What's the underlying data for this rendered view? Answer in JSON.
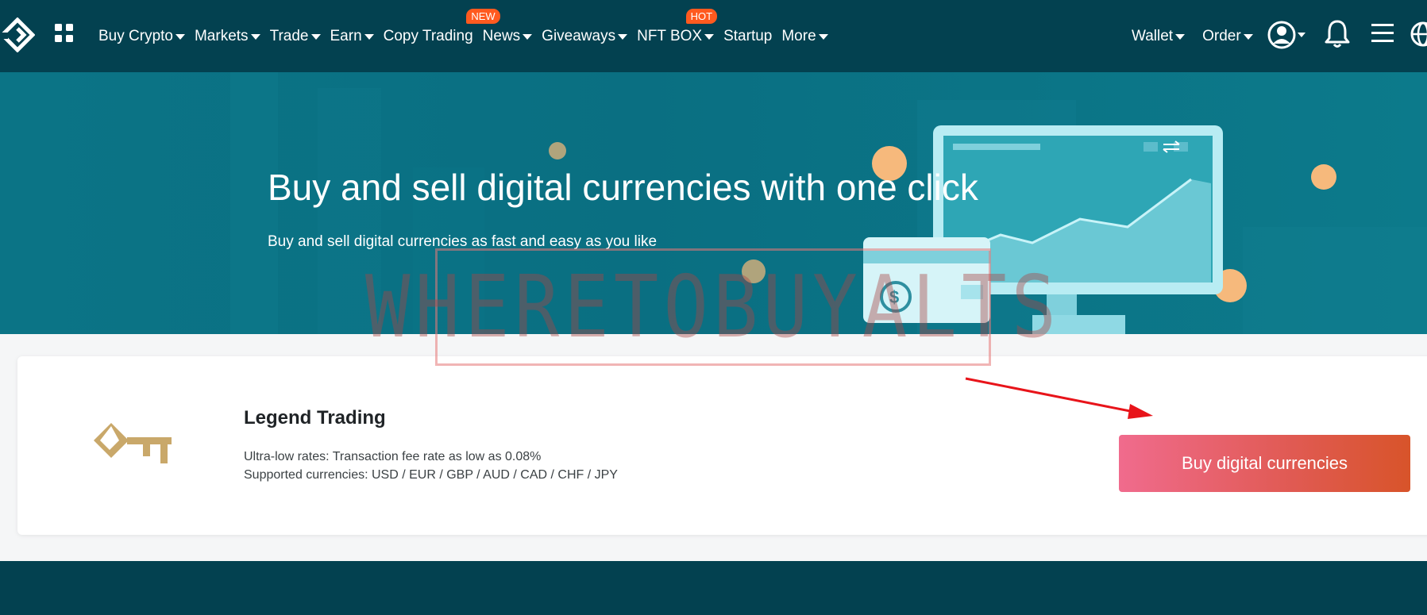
{
  "topnav": {
    "logo_icon": "exchange-logo-icon",
    "apps_icon": "grid-apps-icon",
    "menu": [
      {
        "label": "Buy Crypto",
        "dropdown": true
      },
      {
        "label": "Markets",
        "dropdown": true
      },
      {
        "label": "Trade",
        "dropdown": true
      },
      {
        "label": "Earn",
        "dropdown": true
      },
      {
        "label": "Copy Trading",
        "dropdown": false,
        "badge": "NEW"
      },
      {
        "label": "News",
        "dropdown": true
      },
      {
        "label": "Giveaways",
        "dropdown": true
      },
      {
        "label": "NFT BOX",
        "dropdown": true,
        "badge": "HOT"
      },
      {
        "label": "Startup",
        "dropdown": false
      },
      {
        "label": "More",
        "dropdown": true
      }
    ],
    "right": {
      "wallet_label": "Wallet",
      "order_label": "Order",
      "user_icon": "user-avatar-icon",
      "bell_icon": "bell-icon",
      "menu_icon": "hamburger-menu-icon",
      "language_icon": "globe-icon"
    }
  },
  "hero": {
    "title": "Buy and sell digital currencies with one click",
    "subtitle": "Buy and sell digital currencies as fast and easy as you like",
    "illustration": "monitor-chart-card-illustration"
  },
  "card": {
    "icon": "key-icon",
    "title": "Legend Trading",
    "line1": "Ultra-low rates: Transaction fee rate as low as 0.08%",
    "line2": "Supported currencies: USD / EUR / GBP / AUD / CAD / CHF / JPY",
    "button_label": "Buy digital currencies"
  },
  "overlay": {
    "watermark_text": "WHERETOBUYALTS",
    "arrow_color": "#e8141a"
  },
  "colors": {
    "nav_bg": "#034150",
    "hero_bg": "#0b7486",
    "badge": "#ff5a1f",
    "key_gold": "#c9a86a",
    "button_start": "#f06b8d",
    "button_end": "#d8542a"
  }
}
